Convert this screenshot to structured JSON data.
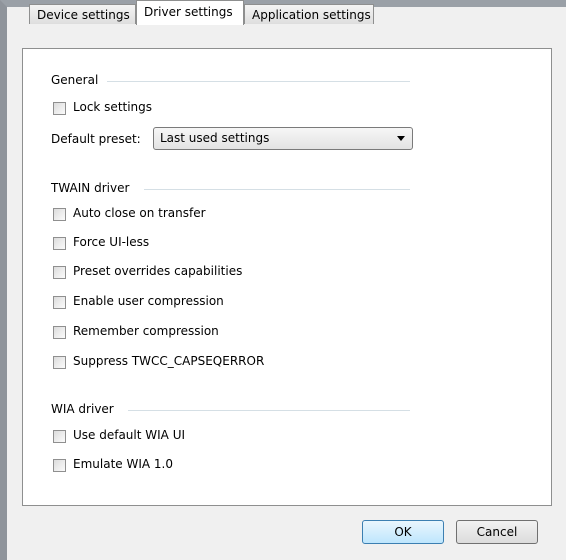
{
  "tabs": [
    {
      "label": "Device settings",
      "active": false
    },
    {
      "label": "Driver settings",
      "active": true
    },
    {
      "label": "Application settings",
      "active": false
    }
  ],
  "general": {
    "title": "General",
    "lock_settings": {
      "label": "Lock settings",
      "checked": false
    },
    "default_preset_label": "Default preset:",
    "default_preset_value": "Last used settings"
  },
  "twain": {
    "title": "TWAIN driver",
    "options": [
      {
        "label": "Auto close on transfer",
        "checked": false
      },
      {
        "label": "Force UI-less",
        "checked": false
      },
      {
        "label": "Preset overrides capabilities",
        "checked": false
      },
      {
        "label": "Enable user compression",
        "checked": false
      },
      {
        "label": "Remember compression",
        "checked": false
      },
      {
        "label": "Suppress TWCC_CAPSEQERROR",
        "checked": false
      }
    ]
  },
  "wia": {
    "title": "WIA driver",
    "options": [
      {
        "label": "Use default WIA UI",
        "checked": false
      },
      {
        "label": "Emulate WIA 1.0",
        "checked": false
      }
    ]
  },
  "buttons": {
    "ok": "OK",
    "cancel": "Cancel"
  }
}
